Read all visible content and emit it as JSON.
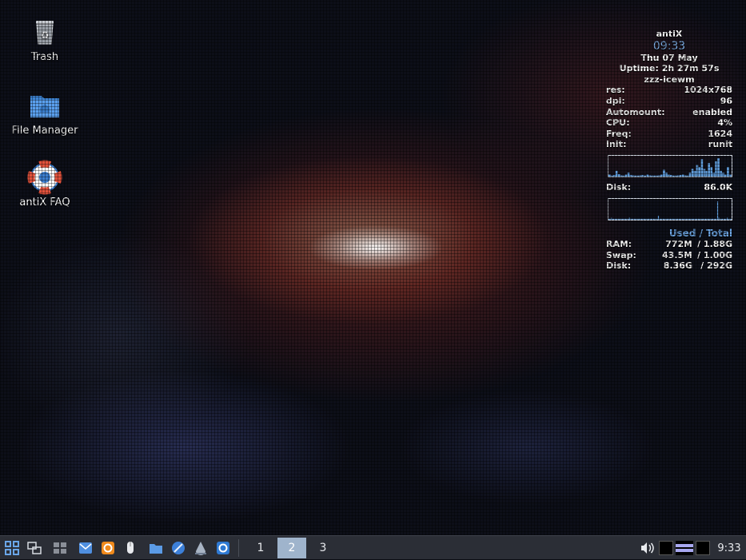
{
  "desktop": {
    "icons": [
      {
        "label": "Trash",
        "icon": "trash-icon"
      },
      {
        "label": "File Manager",
        "icon": "folder-icon"
      },
      {
        "label": "antiX FAQ",
        "icon": "lifebuoy-icon"
      }
    ]
  },
  "conky": {
    "hostname": "antiX",
    "time": "09:33",
    "date": "Thu 07 May",
    "uptime": "Uptime: 2h 27m 57s",
    "wm": "zzz-icewm",
    "stats": [
      {
        "key": "res:",
        "value": "1024x768"
      },
      {
        "key": "dpi:",
        "value": "96"
      },
      {
        "key": "Automount:",
        "value": "enabled"
      },
      {
        "key": "CPU:",
        "value": "4%"
      },
      {
        "key": "Freq:",
        "value": "1624"
      },
      {
        "key": "Init:",
        "value": "runit"
      }
    ],
    "disk_io": {
      "key": "Disk:",
      "value": "86.0K"
    },
    "usage_header": "Used / Total",
    "usage": [
      {
        "key": "RAM:",
        "used": "772M",
        "total": "/ 1.88G"
      },
      {
        "key": "Swap:",
        "used": "43.5M",
        "total": "/ 1.00G"
      },
      {
        "key": "Disk:",
        "used": "8.36G",
        "total": "/ 292G"
      }
    ],
    "cpu_graph": [
      0.1,
      0.05,
      0.08,
      0.3,
      0.12,
      0.06,
      0.05,
      0.1,
      0.2,
      0.08,
      0.06,
      0.05,
      0.05,
      0.06,
      0.08,
      0.05,
      0.1,
      0.06,
      0.05,
      0.05,
      0.05,
      0.06,
      0.1,
      0.35,
      0.2,
      0.1,
      0.08,
      0.05,
      0.05,
      0.06,
      0.08,
      0.1,
      0.06,
      0.05,
      0.2,
      0.4,
      0.3,
      0.6,
      0.5,
      0.9,
      0.4,
      0.3,
      0.7,
      0.5,
      0.2,
      0.8,
      0.95,
      0.3,
      0.2,
      0.1,
      0.5,
      0.1
    ],
    "disk_graph": [
      0.05,
      0.05,
      0.1,
      0.05,
      0.05,
      0.05,
      0.05,
      0.05,
      0.05,
      0.05,
      0.05,
      0.05,
      0.05,
      0.05,
      0.05,
      0.05,
      0.05,
      0.1,
      0.05,
      0.05,
      0.05,
      0.05,
      0.05,
      0.05,
      0.05,
      0.05,
      0.05,
      0.05,
      0.05,
      0.05,
      0.05,
      0.05,
      0.05,
      0.05,
      0.05,
      0.05,
      0.05,
      0.05,
      0.05,
      0.05,
      0.05,
      0.2,
      0.05,
      0.05,
      0.05,
      0.05,
      0.05,
      0.05,
      0.05,
      0.05,
      0.05,
      0.05,
      0.05,
      0.05,
      0.05,
      0.05,
      0.05,
      0.05,
      0.05,
      0.05,
      0.05,
      0.05,
      0.05,
      0.05,
      0.05,
      0.05,
      0.05,
      0.05,
      0.05,
      0.05,
      0.05,
      0.05,
      0.05,
      0.05,
      0.05,
      0.05,
      0.05,
      0.05,
      0.05,
      0.05,
      0.05,
      0.05,
      0.05,
      0.05,
      0.05,
      0.05,
      0.05,
      0.05,
      0.05,
      0.05,
      0.95,
      0.1,
      0.05,
      0.05,
      0.05,
      0.05,
      0.05,
      0.05,
      0.1,
      0.05,
      0.05,
      0.05
    ]
  },
  "taskbar": {
    "launchers": [
      "menu-icon",
      "show-desktop-icon",
      "window-list-icon",
      "mail-icon",
      "software-update-icon",
      "mouse-icon",
      "files-icon",
      "browser-icon",
      "droplet-icon",
      "sync-icon"
    ],
    "workspaces": [
      "1",
      "2",
      "3"
    ],
    "active_workspace": "2",
    "clock": "9:33"
  },
  "colors": {
    "accent": "#6fa8e6",
    "taskbar": "#2b2e36",
    "active_ws": "#9fb4cc"
  }
}
